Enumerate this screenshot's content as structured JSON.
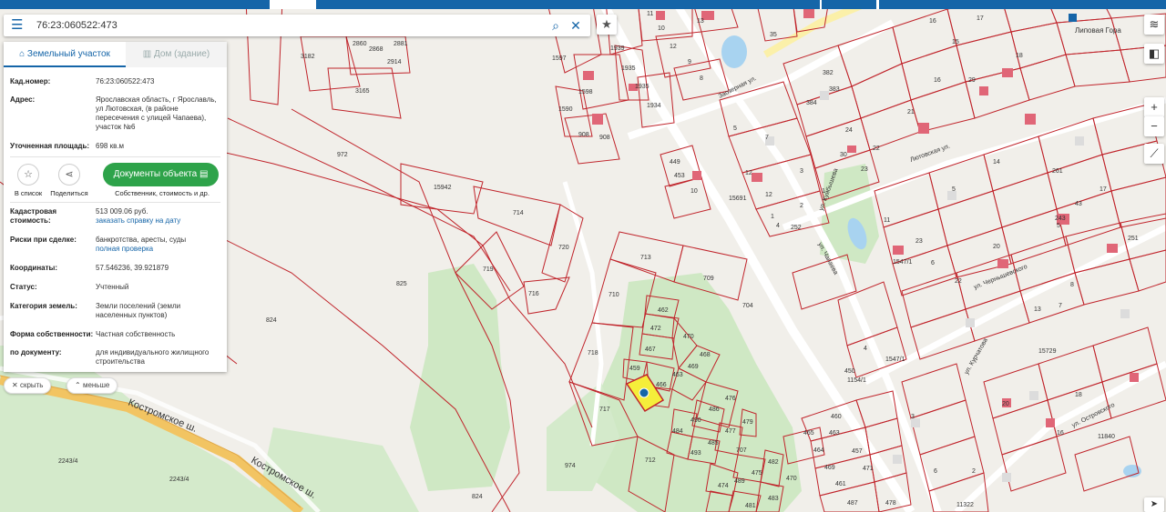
{
  "search": {
    "value": "76:23:060522:473",
    "menu_icon": "hamburger-icon",
    "search_icon": "magnifier-icon",
    "clear_icon": "close-icon"
  },
  "bookmark_icon": "star-icon",
  "panel": {
    "tab_land": "Земельный участок",
    "tab_building": "Дом (здание)",
    "cadnum_label": "Кад.номер:",
    "cadnum_value": "76:23:060522:473",
    "address_label": "Адрес:",
    "address_value": "Ярославская область, г Ярославль, ул Лютовская, (в районе пересечения с улицей Чапаева), участок №6",
    "area_label": "Уточненная площадь:",
    "area_value": "698 кв.м",
    "act_list": "В список",
    "act_share": "Поделиться",
    "doc_button": "Документы объекта",
    "doc_sub": "Собственник, стоимость и др.",
    "cost_label": "Кадастровая стоимость:",
    "cost_value": "513 009.06 руб.",
    "cost_link": "заказать справку на дату",
    "risk_label": "Риски при сделке:",
    "risk_value": "банкротства, аресты, суды",
    "risk_link": "полная проверка",
    "coord_label": "Координаты:",
    "coord_value": "57.546236, 39.921879",
    "status_label": "Статус:",
    "status_value": "Учтенный",
    "cat_label": "Категория земель:",
    "cat_value": "Земли поселений (земли населенных пунктов)",
    "own_label": "Форма собственности:",
    "own_value": "Частная собственность",
    "doc_label": "по документу:",
    "doc_value": "для индивидуального жилищного строительства"
  },
  "pills": {
    "hide": "скрыть",
    "less": "меньше"
  },
  "controls": {
    "layers_icon": "layers-icon",
    "basemap_icon": "basemap-icon",
    "zoom_in": "+",
    "zoom_out": "−",
    "ruler_icon": "ruler-icon",
    "compass_icon": "compass-icon"
  },
  "map": {
    "streets": {
      "kostroma1": "Костромское ш.",
      "kostroma2": "Костромское ш.",
      "chapaeva": "ул. Чапаева",
      "lyutovskaya": "Лютовская ул.",
      "zaozernaya": "Заозерная ул.",
      "chernoblev": "ул. Чернышевского",
      "ostrovskogo": "ул. Островского",
      "kurchatova": "ул. Курчатова",
      "kuibyshev": "ул. Куйбышева"
    },
    "place": "Липовая Гора",
    "parcels": [
      "3182",
      "3165",
      "2860",
      "2868",
      "2881",
      "2914",
      "972",
      "15942",
      "714",
      "720",
      "719",
      "716",
      "825",
      "824",
      "713",
      "709",
      "710",
      "718",
      "717",
      "712",
      "704",
      "974",
      "2243/4",
      "2243/4",
      "824",
      "462",
      "472",
      "470",
      "467",
      "463",
      "459",
      "469",
      "468",
      "466",
      "476",
      "486",
      "490",
      "484",
      "493",
      "485",
      "477",
      "479",
      "482",
      "474",
      "489",
      "483",
      "481",
      "475",
      "470",
      "707",
      "465",
      "464",
      "463",
      "460",
      "457",
      "471",
      "469",
      "461",
      "487",
      "478",
      "1597",
      "1598",
      "1590",
      "1939",
      "1935",
      "1934",
      "1935",
      "908",
      "908",
      "13",
      "17",
      "16",
      "15",
      "11",
      "12",
      "10",
      "8",
      "9",
      "5",
      "7",
      "35",
      "382",
      "383",
      "384",
      "24",
      "30",
      "23",
      "22",
      "29",
      "16",
      "18",
      "14",
      "21",
      "23",
      "22",
      "20",
      "11",
      "13",
      "5",
      "4",
      "3",
      "2",
      "4",
      "6",
      "7",
      "8",
      "12",
      "1",
      "243",
      "251",
      "261",
      "43",
      "17",
      "3",
      "2",
      "6",
      "16",
      "18",
      "20",
      "15729",
      "11840",
      "11322",
      "1547/1",
      "15691",
      "1547/1",
      "1154/1",
      "450",
      "449",
      "453",
      "10",
      "12",
      "1",
      "252",
      "5"
    ],
    "coords_road": ""
  }
}
